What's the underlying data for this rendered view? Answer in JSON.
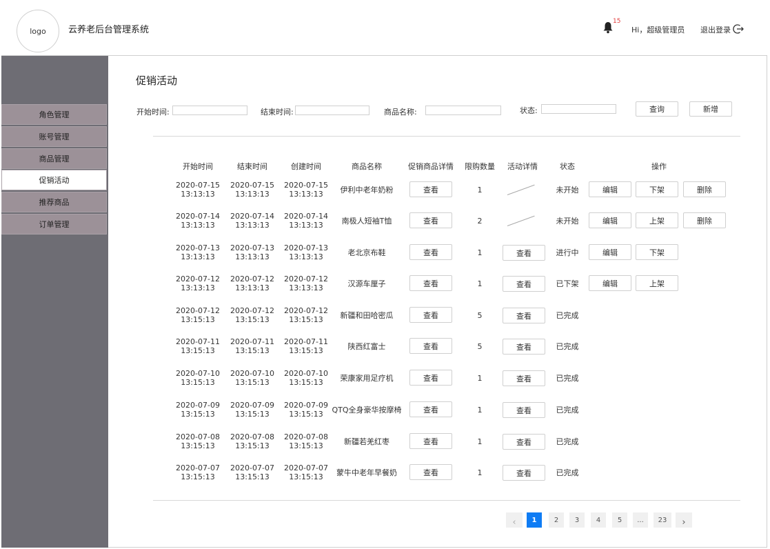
{
  "header": {
    "logo_text": "logo",
    "app_title": "云养老后台管理系统",
    "notification_count": "15",
    "greeting": "Hi，超级管理员",
    "logout_label": "退出登录"
  },
  "sidebar": {
    "items": [
      {
        "label": "角色管理",
        "active": false
      },
      {
        "label": "账号管理",
        "active": false
      },
      {
        "label": "商品管理",
        "active": false
      },
      {
        "label": "促销活动",
        "active": true
      },
      {
        "label": "推荐商品",
        "active": false
      },
      {
        "label": "订单管理",
        "active": false
      }
    ]
  },
  "page": {
    "title": "促销活动"
  },
  "filters": {
    "start_label": "开始时间:",
    "end_label": "结束时间:",
    "product_label": "商品名称:",
    "status_label": "状态:",
    "start_value": "",
    "end_value": "",
    "product_value": "",
    "status_value": "",
    "query_button": "查询",
    "add_button": "新增"
  },
  "table": {
    "columns": [
      "开始时间",
      "结束时间",
      "创建时间",
      "商品名称",
      "促销商品详情",
      "限购数量",
      "活动详情",
      "状态",
      "操作"
    ],
    "view_label": "查看",
    "rows": [
      {
        "start": "2020-07-15",
        "start_time": "13:13:13",
        "end": "2020-07-15",
        "end_time": "13:13:13",
        "created": "2020-07-15",
        "created_time": "13:13:13",
        "product": "伊利中老年奶粉",
        "limit": "1",
        "detail": null,
        "status": "未开始",
        "actions": [
          "编辑",
          "下架",
          "删除"
        ]
      },
      {
        "start": "2020-07-14",
        "start_time": "13:13:13",
        "end": "2020-07-14",
        "end_time": "13:13:13",
        "created": "2020-07-14",
        "created_time": "13:13:13",
        "product": "南极人短袖T恤",
        "limit": "2",
        "detail": null,
        "status": "未开始",
        "actions": [
          "编辑",
          "上架",
          "删除"
        ]
      },
      {
        "start": "2020-07-13",
        "start_time": "13:13:13",
        "end": "2020-07-13",
        "end_time": "13:13:13",
        "created": "2020-07-13",
        "created_time": "13:13:13",
        "product": "老北京布鞋",
        "limit": "1",
        "detail": "查看",
        "status": "进行中",
        "actions": [
          "编辑",
          "下架"
        ]
      },
      {
        "start": "2020-07-12",
        "start_time": "13:13:13",
        "end": "2020-07-12",
        "end_time": "13:13:13",
        "created": "2020-07-12",
        "created_time": "13:13:13",
        "product": "汉源车厘子",
        "limit": "1",
        "detail": "查看",
        "status": "已下架",
        "actions": [
          "编辑",
          "上架"
        ]
      },
      {
        "start": "2020-07-12",
        "start_time": "13:15:13",
        "end": "2020-07-12",
        "end_time": "13:15:13",
        "created": "2020-07-12",
        "created_time": "13:15:13",
        "product": "新疆和田哈密瓜",
        "limit": "5",
        "detail": "查看",
        "status": "已完成",
        "actions": []
      },
      {
        "start": "2020-07-11",
        "start_time": "13:15:13",
        "end": "2020-07-11",
        "end_time": "13:15:13",
        "created": "2020-07-11",
        "created_time": "13:15:13",
        "product": "陕西红富士",
        "limit": "5",
        "detail": "查看",
        "status": "已完成",
        "actions": []
      },
      {
        "start": "2020-07-10",
        "start_time": "13:15:13",
        "end": "2020-07-10",
        "end_time": "13:15:13",
        "created": "2020-07-10",
        "created_time": "13:15:13",
        "product": "荣康家用足疗机",
        "limit": "1",
        "detail": "查看",
        "status": "已完成",
        "actions": []
      },
      {
        "start": "2020-07-09",
        "start_time": "13:15:13",
        "end": "2020-07-09",
        "end_time": "13:15:13",
        "created": "2020-07-09",
        "created_time": "13:15:13",
        "product": "QTQ全身豪华按摩椅",
        "limit": "1",
        "detail": "查看",
        "status": "已完成",
        "actions": []
      },
      {
        "start": "2020-07-08",
        "start_time": "13:15:13",
        "end": "2020-07-08",
        "end_time": "13:15:13",
        "created": "2020-07-08",
        "created_time": "13:15:13",
        "product": "新疆若羌红枣",
        "limit": "1",
        "detail": "查看",
        "status": "已完成",
        "actions": []
      },
      {
        "start": "2020-07-07",
        "start_time": "13:15:13",
        "end": "2020-07-07",
        "end_time": "13:15:13",
        "created": "2020-07-07",
        "created_time": "13:15:13",
        "product": "蒙牛中老年早餐奶",
        "limit": "1",
        "detail": "查看",
        "status": "已完成",
        "actions": []
      }
    ]
  },
  "pagination": {
    "prev": "‹",
    "pages": [
      "1",
      "2",
      "3",
      "4",
      "5",
      "...",
      "23"
    ],
    "current": "1",
    "next": "›"
  },
  "colors": {
    "sidebar_bg": "#6e6d74",
    "sidebar_item_bg": "#9c9198",
    "accent": "#0f7cf4",
    "badge": "#e23b3b"
  }
}
